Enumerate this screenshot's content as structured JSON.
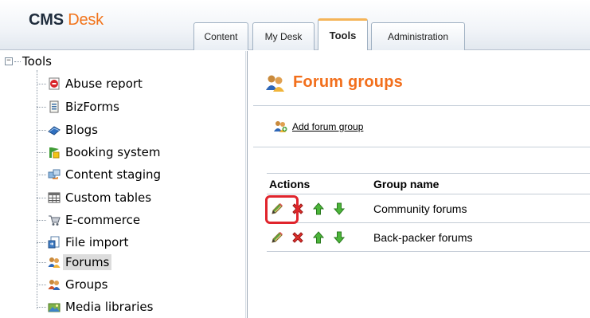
{
  "app": {
    "logo_cms": "CMS",
    "logo_desk": "Desk"
  },
  "tabs": [
    {
      "label": "Content",
      "active": false
    },
    {
      "label": "My Desk",
      "active": false
    },
    {
      "label": "Tools",
      "active": true
    },
    {
      "label": "Administration",
      "active": false
    }
  ],
  "sidebar": {
    "root_expander": "−",
    "root_label": "Tools",
    "items": [
      {
        "label": "Abuse report",
        "icon": "abuse-report-icon"
      },
      {
        "label": "BizForms",
        "icon": "bizforms-icon"
      },
      {
        "label": "Blogs",
        "icon": "blogs-icon"
      },
      {
        "label": "Booking system",
        "icon": "booking-system-icon"
      },
      {
        "label": "Content staging",
        "icon": "content-staging-icon"
      },
      {
        "label": "Custom tables",
        "icon": "custom-tables-icon"
      },
      {
        "label": "E-commerce",
        "icon": "e-commerce-icon"
      },
      {
        "label": "File import",
        "icon": "file-import-icon"
      },
      {
        "label": "Forums",
        "icon": "forums-icon",
        "selected": true
      },
      {
        "label": "Groups",
        "icon": "groups-icon"
      },
      {
        "label": "Media libraries",
        "icon": "media-libraries-icon"
      }
    ]
  },
  "main": {
    "page_title": "Forum groups",
    "add_link": "Add forum group",
    "table": {
      "columns": [
        "Actions",
        "Group name"
      ],
      "rows": [
        {
          "name": "Community forums"
        },
        {
          "name": "Back-packer forums"
        }
      ]
    }
  },
  "colors": {
    "accent_orange": "#f26f1c",
    "highlight_red": "#e0242c",
    "tab_active_border": "#f5b458"
  }
}
